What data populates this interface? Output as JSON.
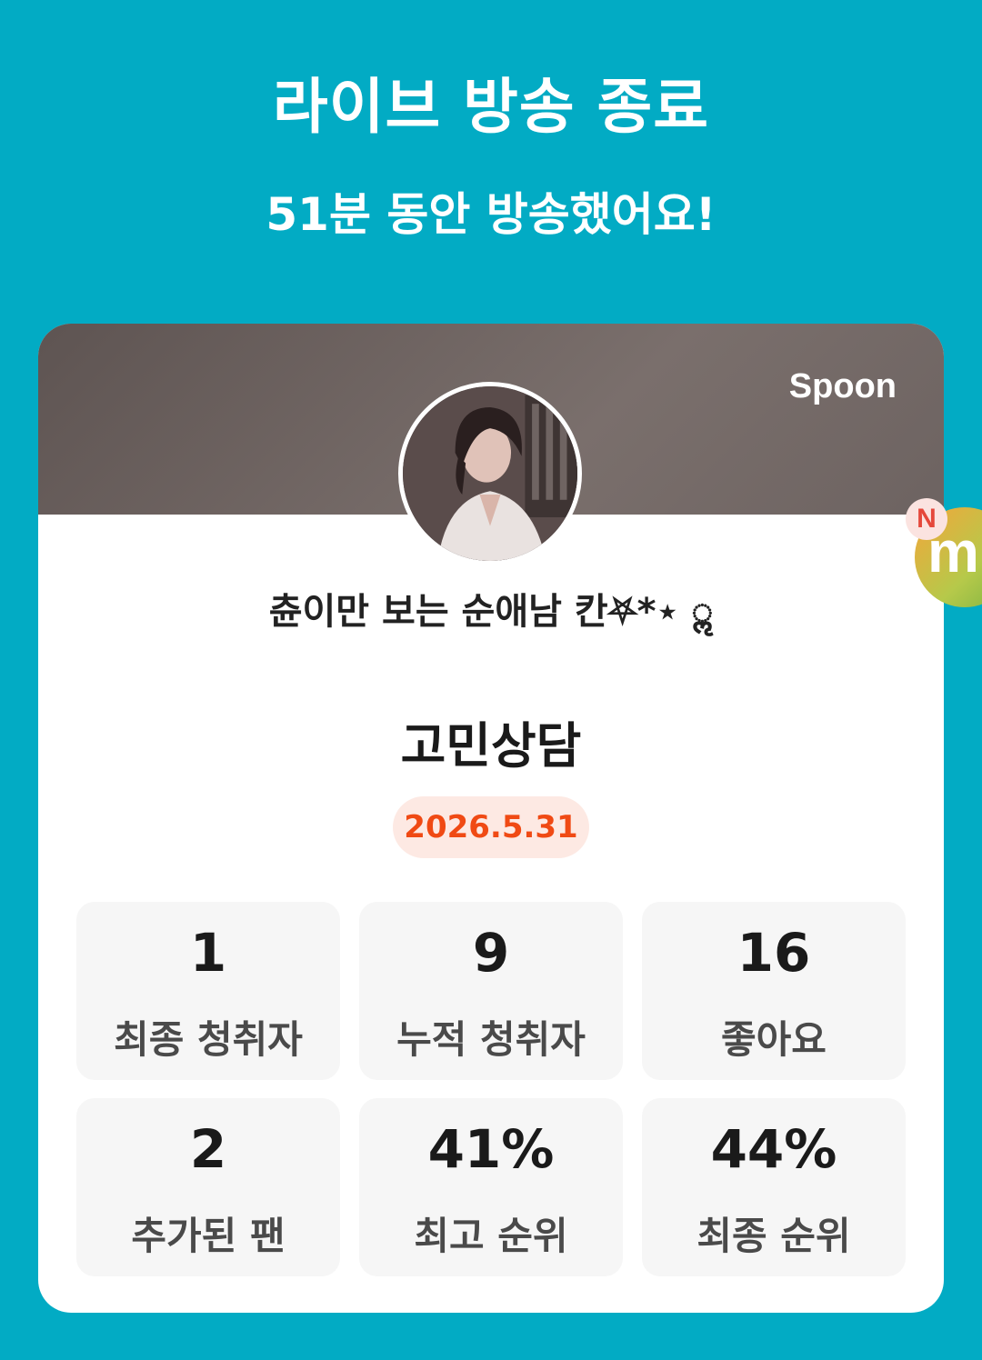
{
  "header": {
    "title": "라이브 방송 종료",
    "subtitle": "51분 동안 방송했어요!"
  },
  "card": {
    "brand": "Spoon",
    "dj_name": "츈이만 보는 순애남 칸⛧*⋆ ॢ",
    "live_title": "고민상담",
    "date": "2026.5.31"
  },
  "stats": [
    {
      "value": "1",
      "label": "최종 청취자"
    },
    {
      "value": "9",
      "label": "누적 청취자"
    },
    {
      "value": "16",
      "label": "좋아요"
    },
    {
      "value": "2",
      "label": "추가된 팬"
    },
    {
      "value": "41%",
      "label": "최고 순위"
    },
    {
      "value": "44%",
      "label": "최종 순위"
    }
  ],
  "floating": {
    "badge_letter": "m",
    "dot_letter": "N"
  }
}
